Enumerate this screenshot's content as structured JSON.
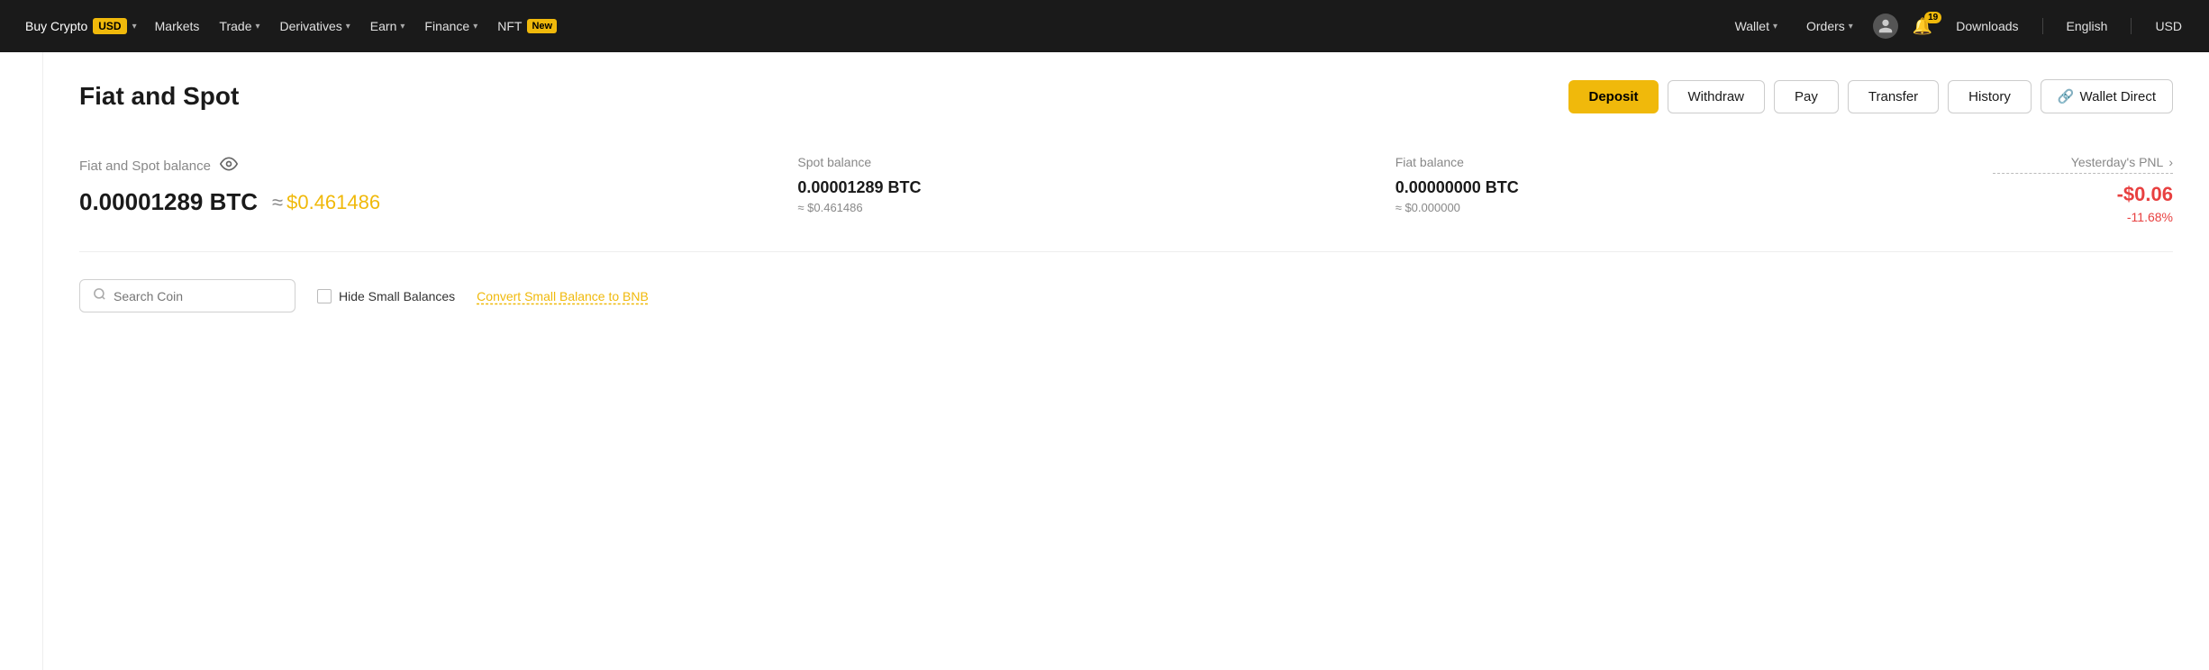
{
  "topnav": {
    "buy_crypto": "Buy Crypto",
    "usd_badge": "USD",
    "markets": "Markets",
    "trade": "Trade",
    "derivatives": "Derivatives",
    "earn": "Earn",
    "finance": "Finance",
    "nft": "NFT",
    "nft_badge": "New",
    "wallet": "Wallet",
    "orders": "Orders",
    "downloads": "Downloads",
    "english": "English",
    "usd": "USD",
    "notif_count": "19"
  },
  "page": {
    "title": "Fiat and Spot",
    "deposit_label": "Deposit",
    "withdraw_label": "Withdraw",
    "pay_label": "Pay",
    "transfer_label": "Transfer",
    "history_label": "History",
    "wallet_direct_label": "Wallet Direct"
  },
  "balance": {
    "label": "Fiat and Spot balance",
    "btc": "0.00001289 BTC",
    "approx": "≈",
    "usd": "$0.461486",
    "spot_label": "Spot balance",
    "spot_btc": "0.00001289 BTC",
    "spot_usd": "≈ $0.461486",
    "fiat_label": "Fiat balance",
    "fiat_btc": "0.00000000 BTC",
    "fiat_usd": "≈ $0.000000",
    "pnl_label": "Yesterday's PNL",
    "pnl_value": "-$0.06",
    "pnl_pct": "-11.68%"
  },
  "filters": {
    "search_placeholder": "Search Coin",
    "hide_small_label": "Hide Small Balances",
    "convert_label": "Convert Small Balance to BNB"
  }
}
